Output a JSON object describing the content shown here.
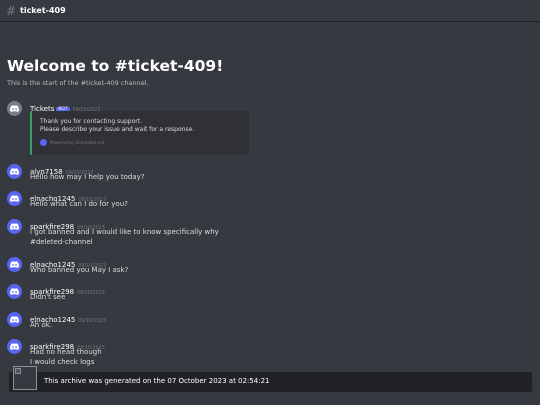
{
  "channel": {
    "name": "ticket-409",
    "hash_icon": "hash-icon"
  },
  "welcome": {
    "title": "Welcome to #ticket-409!",
    "subtitle": "This is the start of the #ticket-409 channel."
  },
  "messages": [
    {
      "author": "Tickets",
      "bot_tag": "BOT",
      "timestamp": "09/10/2023",
      "embed": {
        "line1": "Thank you for contacting support.",
        "line2": "Please describe your issue and wait for a response.",
        "footer": "Powered by ticketsbot.net",
        "accent_color": "#3ba55d"
      }
    },
    {
      "author": "alyn7158",
      "timestamp": "09/10/2023",
      "lines": [
        "Hello how may I help you today?"
      ]
    },
    {
      "author": "elnacho1245",
      "timestamp": "09/10/2023",
      "lines": [
        "Hello what can I do for you?"
      ]
    },
    {
      "author": "sparkfire298",
      "timestamp": "09/10/2023",
      "lines": [
        "I got banned and I would like to know specifically why",
        "#deleted-channel"
      ]
    },
    {
      "author": "elnacho1245",
      "timestamp": "09/10/2023",
      "lines": [
        "Who banned you May I ask?"
      ]
    },
    {
      "author": "sparkfire298",
      "timestamp": "09/10/2023",
      "lines": [
        "Didn't see"
      ]
    },
    {
      "author": "elnacho1245",
      "timestamp": "09/10/2023",
      "lines": [
        "Ah ok."
      ]
    },
    {
      "author": "sparkfire298",
      "timestamp": "09/10/2023",
      "lines": [
        "Had no head though",
        "I would check logs"
      ]
    }
  ],
  "footer": {
    "text": "This archive was generated on the  07 October 2023 at 02:54:21"
  },
  "colors": {
    "background": "#36393f",
    "blurple": "#5865f2",
    "embed_bg": "#2f3136",
    "footer_bg": "#202225"
  }
}
